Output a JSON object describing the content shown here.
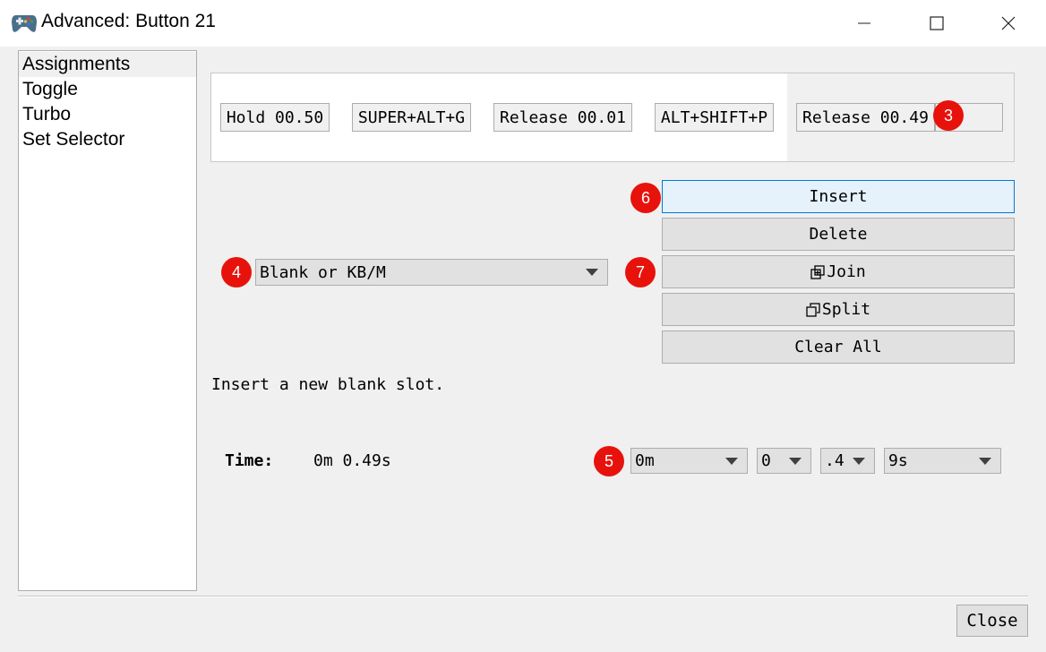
{
  "window": {
    "title": "Advanced: Button 21",
    "icon": "gamepad-icon",
    "minimize": "minimize-icon",
    "maximize": "maximize-icon",
    "close": "close-icon"
  },
  "sidebar": {
    "items": [
      {
        "label": "Assignments",
        "selected": true
      },
      {
        "label": "Toggle"
      },
      {
        "label": "Turbo"
      },
      {
        "label": "Set Selector"
      }
    ]
  },
  "slots": [
    {
      "label": "Hold 00.50"
    },
    {
      "label": "SUPER+ALT+G"
    },
    {
      "label": "Release 00.01"
    },
    {
      "label": "ALT+SHIFT+P"
    },
    {
      "label": "Release 00.49"
    },
    {
      "label": ""
    }
  ],
  "slot_type": {
    "selected": "Blank or KB/M"
  },
  "actions": {
    "insert": "Insert",
    "delete": "Delete",
    "join": "Join",
    "split": "Split",
    "clear_all": "Clear All"
  },
  "description": "Insert a new blank slot.",
  "time": {
    "label": "Time:",
    "value": "0m 0.49s",
    "minutes": "0m",
    "seconds": "0",
    "tenths": ".4",
    "hundredths": "9s"
  },
  "badges": {
    "b3": "3",
    "b4": "4",
    "b5": "5",
    "b6": "6",
    "b7": "7"
  },
  "footer": {
    "close": "Close"
  },
  "colors": {
    "badge": "#e8120c",
    "focus": "#0078d7"
  }
}
